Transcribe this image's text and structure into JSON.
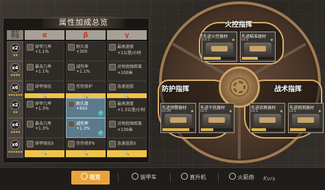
{
  "panel": {
    "title": "属性加成总览",
    "corner_top": "类型",
    "corner_bottom": "星级",
    "col_a": "α",
    "col_b": "β",
    "col_g": "γ"
  },
  "rows": [
    {
      "mult": "x2",
      "stars": "★★",
      "a": {
        "icon": "target-icon",
        "name": "穿甲几率",
        "value": "+1.1%"
      },
      "b": {
        "icon": "heart-icon",
        "name": "耐久度",
        "value": "+300"
      },
      "g": {
        "icon": "speed-icon",
        "name": "最高速度",
        "value": "+1公里/小时"
      }
    },
    {
      "mult": "x4",
      "stars": "★★★★",
      "a": {
        "icon": "crit-icon",
        "name": "暴击几率",
        "value": "+1.1%"
      },
      "b": {
        "icon": "shield-icon",
        "name": "减伤率",
        "value": "+1.1%"
      },
      "g": {
        "icon": "range-icon",
        "name": "对地炮弹距离",
        "value": "+100米"
      }
    },
    {
      "mult": "x6",
      "stars": "★★★★★★",
      "a": {
        "icon": "pierce-icon",
        "name": "穿甲强化",
        "value": ""
      },
      "b": {
        "icon": "repair-icon",
        "name": "伤伤修护",
        "value": ""
      },
      "g": {
        "icon": "boost-icon",
        "name": "急速巡航",
        "value": ""
      }
    },
    {
      "mult": "x2",
      "stars": "★★",
      "a": {
        "icon": "target-icon",
        "name": "穿甲几率",
        "value": "+1.3%"
      },
      "b": {
        "icon": "heart-icon",
        "name": "耐久度",
        "value": "+650",
        "highlight": true
      },
      "g": {
        "icon": "speed-icon",
        "name": "最高速度",
        "value": "+1.3公里/小时"
      }
    },
    {
      "mult": "x4",
      "stars": "★★★★",
      "a": {
        "icon": "crit-icon",
        "name": "暴击几率",
        "value": "+1.3%"
      },
      "b": {
        "icon": "shield-icon",
        "name": "减伤率",
        "value": "+1.3%",
        "highlight": true
      },
      "g": {
        "icon": "range-icon",
        "name": "对地炮弹距离",
        "value": "+130米"
      }
    },
    {
      "mult": "x6",
      "stars": "★★★★★★",
      "a": {
        "icon": "pierce-icon",
        "name": "穿甲强化Ⅱ",
        "value": ""
      },
      "b": {
        "icon": "repair-icon",
        "name": "伤伤修护Ⅱ",
        "value": ""
      },
      "g": {
        "icon": "boost-icon",
        "name": "急速巡航Ⅱ",
        "value": ""
      }
    }
  ],
  "wheel": {
    "fire_label": "火控指挥",
    "defense_label": "防护指挥",
    "tactic_label": "战术指挥",
    "cards": [
      {
        "name": "先进火控器材",
        "level": "Lv.1",
        "progress": 0.55
      },
      {
        "name": "先进瞄准器材",
        "level": "Lv.1",
        "progress": 0.5
      },
      {
        "name": "先进预警器材",
        "level": "Lv.20",
        "progress": 0.85
      },
      {
        "name": "先进干扰器材",
        "level": "Lv.1",
        "progress": 0.4
      },
      {
        "name": "先进侦察器材",
        "level": "Lv.1",
        "progress": 0.45
      },
      {
        "name": "先进观测器材",
        "level": "Lv.1",
        "progress": 0.5
      }
    ]
  },
  "tabs": [
    {
      "label": "坦克",
      "icon": "tank-icon"
    },
    {
      "label": "装甲车",
      "icon": "armored-car-icon"
    },
    {
      "label": "直升机",
      "icon": "helicopter-icon"
    },
    {
      "label": "火箭炮",
      "icon": "rocket-icon"
    }
  ],
  "watermark": "Kvrs",
  "colors": {
    "accent": "#e8a43a",
    "highlight": "#5b7a8c",
    "star": "#f3c246",
    "header_text": "#c23a2a"
  }
}
